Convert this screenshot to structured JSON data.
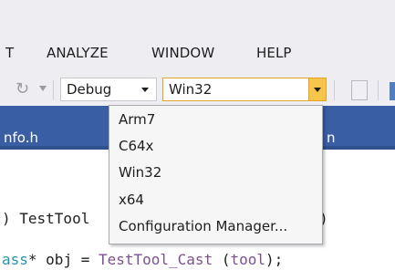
{
  "menubar": {
    "items": [
      {
        "label": "T"
      },
      {
        "label": "ANALYZE"
      },
      {
        "label": "WINDOW"
      },
      {
        "label": "HELP"
      }
    ]
  },
  "toolbar": {
    "redo_icon": "redo-icon",
    "configuration": {
      "value": "Debug"
    },
    "platform": {
      "value": "Win32"
    }
  },
  "tabs": {
    "left_text": "nfo.h",
    "right_text": "n"
  },
  "editor": {
    "line1_prefix": ") TestTool",
    "line1_suffix": ")",
    "line2_a": "ass",
    "line2_b": "* obj = ",
    "line2_c": "TestTool_Cast",
    "line2_d": " (",
    "line2_e": "tool",
    "line2_f": ");"
  },
  "dropdown": {
    "options": [
      {
        "label": "Arm7"
      },
      {
        "label": "C64x"
      },
      {
        "label": "Win32"
      },
      {
        "label": "x64"
      },
      {
        "label": "Configuration Manager..."
      }
    ]
  },
  "colors": {
    "tab_background": "#3a5ea3",
    "dropdown_button": "#f6c64a",
    "highlight_border": "#e5a32a"
  }
}
